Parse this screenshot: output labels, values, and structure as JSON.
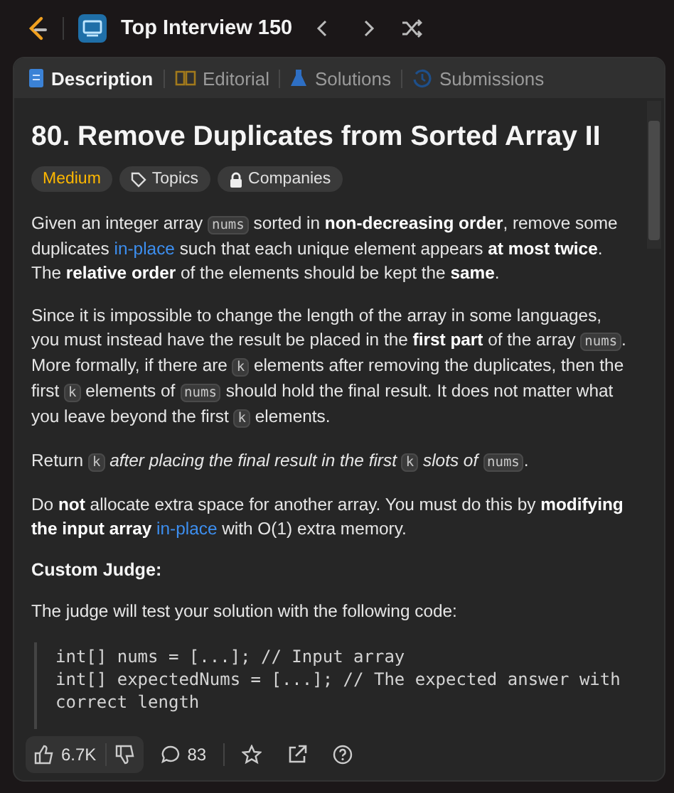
{
  "top_bar": {
    "list_title": "Top Interview 150"
  },
  "tabs": [
    {
      "label": "Description",
      "kind": "doc",
      "selected": true
    },
    {
      "label": "Editorial",
      "kind": "book",
      "selected": false
    },
    {
      "label": "Solutions",
      "kind": "flask",
      "selected": false
    },
    {
      "label": "Submissions",
      "kind": "history",
      "selected": false
    }
  ],
  "problem": {
    "title": "80. Remove Duplicates from Sorted Array II",
    "tags": [
      {
        "label": "Medium",
        "kind": "difficulty"
      },
      {
        "label": "Topics",
        "kind": "tag"
      },
      {
        "label": "Companies",
        "kind": "lock"
      }
    ],
    "paragraphs": [
      [
        {
          "kind": "text",
          "text": "Given an integer array "
        },
        {
          "kind": "code",
          "text": "nums"
        },
        {
          "kind": "text",
          "text": " sorted in **non-decreasing order**, remove some duplicates "
        },
        {
          "kind": "link",
          "text": "in-place"
        },
        {
          "kind": "text",
          "text": " such that each unique element appears **at most twice**. The **relative order** of the elements should be kept the **same**."
        }
      ],
      [
        {
          "kind": "text",
          "text": "Since it is impossible to change the length of the array in some languages, you must instead have the result be placed in the **first part** of the array "
        },
        {
          "kind": "code",
          "text": "nums"
        },
        {
          "kind": "text",
          "text": ". More formally, if there are "
        },
        {
          "kind": "code",
          "text": "k"
        },
        {
          "kind": "text",
          "text": " elements after removing the duplicates, then the first "
        },
        {
          "kind": "code",
          "text": "k"
        },
        {
          "kind": "text",
          "text": " elements of "
        },
        {
          "kind": "code",
          "text": "nums"
        },
        {
          "kind": "text",
          "text": " should hold the final result. It does not matter what you leave beyond the first "
        },
        {
          "kind": "code",
          "text": "k"
        },
        {
          "kind": "text",
          "text": " elements."
        }
      ],
      [
        {
          "kind": "text",
          "text": "Return "
        },
        {
          "kind": "code",
          "text": "k"
        },
        {
          "kind": "text",
          "text": " *after placing the final result in the first* "
        },
        {
          "kind": "code",
          "text": "k"
        },
        {
          "kind": "text",
          "text": " *slots of* "
        },
        {
          "kind": "code",
          "text": "nums"
        },
        {
          "kind": "text",
          "text": "."
        }
      ],
      [
        {
          "kind": "text",
          "text": "Do **not** allocate extra space for another array. You must do this by **modifying the input array** "
        },
        {
          "kind": "link",
          "text": "in-place"
        },
        {
          "kind": "text",
          "text": " with O(1) extra memory."
        }
      ]
    ],
    "section_heading": "Custom Judge:",
    "judge_intro": "The judge will test your solution with the following code:",
    "code_lines": [
      "int[] nums = [...]; // Input array",
      "int[] expectedNums = [...]; // The expected answer with correct length"
    ]
  },
  "footer": {
    "likes": "6.7K",
    "comments": "83"
  }
}
